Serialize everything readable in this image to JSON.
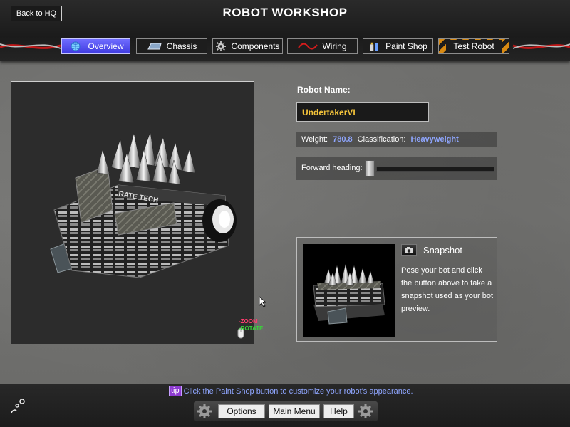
{
  "header": {
    "title": "ROBOT WORKSHOP",
    "back_label": "Back to HQ"
  },
  "tabs": [
    {
      "label": "Overview",
      "icon": "globe-icon",
      "active": true
    },
    {
      "label": "Chassis",
      "icon": "chassis-icon",
      "active": false
    },
    {
      "label": "Components",
      "icon": "gear-icon",
      "active": false
    },
    {
      "label": "Wiring",
      "icon": "wire-icon",
      "active": false
    },
    {
      "label": "Paint Shop",
      "icon": "paint-icon",
      "active": false
    },
    {
      "label": "Test Robot",
      "icon": "hazard-stripes",
      "active": false
    }
  ],
  "viewport": {
    "zoom_label": "-ZOOM",
    "rotate_label": "-ROTATE",
    "robot_decals": "RATE TECH"
  },
  "robot": {
    "name_label": "Robot Name:",
    "name_value": "UndertakerVI",
    "weight_label": "Weight:",
    "weight_value": "780.8",
    "class_label": "Classification:",
    "class_value": "Heavyweight",
    "heading_label": "Forward heading:",
    "heading_value": 0.0
  },
  "snapshot": {
    "title": "Snapshot",
    "description": "Pose your bot and click the button above to take a snapshot used as your bot preview."
  },
  "footer": {
    "tip_badge": "tip",
    "tip_text": "Click the Paint Shop button to customize your robot's appearance.",
    "options_label": "Options",
    "main_menu_label": "Main Menu",
    "help_label": "Help"
  },
  "colors": {
    "accent_blue": "#8fa6ff",
    "name_gold": "#f2c23a",
    "active_tab": "#4f4bef",
    "tip_purple": "#8e3bd1"
  }
}
